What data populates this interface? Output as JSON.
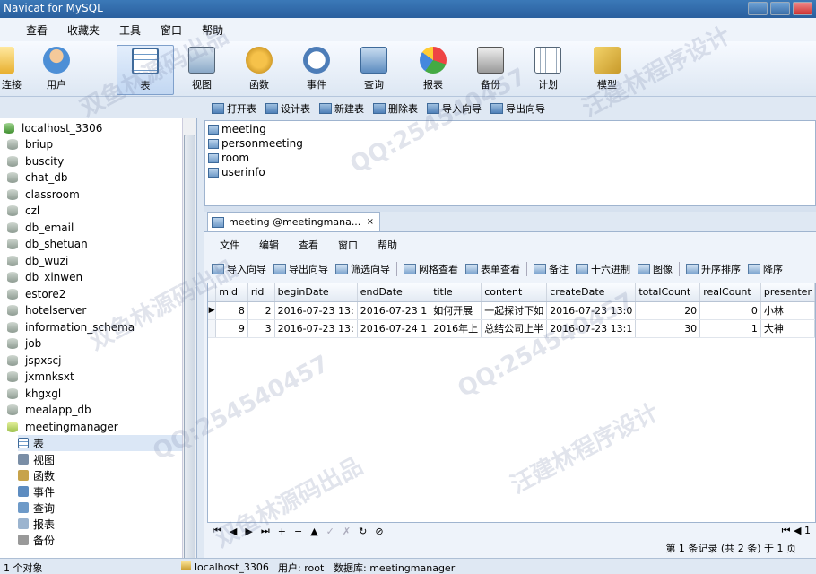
{
  "window": {
    "title": "Navicat for MySQL"
  },
  "menubar": [
    "查看",
    "收藏夹",
    "工具",
    "窗口",
    "帮助"
  ],
  "toolbar": [
    {
      "label": "连接",
      "icon": "connection-icon",
      "active": false
    },
    {
      "label": "用户",
      "icon": "user-icon",
      "active": false
    },
    {
      "label": "表",
      "icon": "table-icon",
      "active": true
    },
    {
      "label": "视图",
      "icon": "view-icon",
      "active": false
    },
    {
      "label": "函数",
      "icon": "function-icon",
      "active": false
    },
    {
      "label": "事件",
      "icon": "event-icon",
      "active": false
    },
    {
      "label": "查询",
      "icon": "query-icon",
      "active": false
    },
    {
      "label": "报表",
      "icon": "report-icon",
      "active": false
    },
    {
      "label": "备份",
      "icon": "backup-icon",
      "active": false
    },
    {
      "label": "计划",
      "icon": "schedule-icon",
      "active": false
    },
    {
      "label": "模型",
      "icon": "model-icon",
      "active": false
    }
  ],
  "object_toolbar": [
    "打开表",
    "设计表",
    "新建表",
    "删除表",
    "导入向导",
    "导出向导"
  ],
  "tree": {
    "connection": "localhost_3306",
    "databases": [
      "briup",
      "buscity",
      "chat_db",
      "classroom",
      "czl",
      "db_email",
      "db_shetuan",
      "db_wuzi",
      "db_xinwen",
      "estore2",
      "hotelserver",
      "information_schema",
      "job",
      "jspxscj",
      "jxmnksxt",
      "khgxgl",
      "mealapp_db",
      "meetingmanager"
    ],
    "sub_items": [
      "表",
      "视图",
      "函数",
      "事件",
      "查询",
      "报表",
      "备份"
    ]
  },
  "tables": [
    "meeting",
    "personmeeting",
    "room",
    "userinfo"
  ],
  "tab": {
    "label": "meeting @meetingmana...",
    "close": "×"
  },
  "inner_menu": [
    "文件",
    "编辑",
    "查看",
    "窗口",
    "帮助"
  ],
  "inner_toolbar": [
    "导入向导",
    "导出向导",
    "筛选向导",
    "网格查看",
    "表单查看",
    "备注",
    "十六进制",
    "图像",
    "升序排序",
    "降序"
  ],
  "grid": {
    "columns": [
      "mid",
      "rid",
      "beginDate",
      "endDate",
      "title",
      "content",
      "createDate",
      "totalCount",
      "realCount",
      "presenter"
    ],
    "rows": [
      [
        "8",
        "2",
        "2016-07-23 13:",
        "2016-07-23 1",
        "如何开展",
        "一起探讨下如",
        "2016-07-23 13:0",
        "20",
        "0",
        "小林"
      ],
      [
        "9",
        "3",
        "2016-07-23 13:",
        "2016-07-24 1",
        "2016年上",
        "总结公司上半",
        "2016-07-23 13:1",
        "30",
        "1",
        "大神"
      ]
    ]
  },
  "navigation": {
    "buttons": [
      "⏮",
      "◀",
      "▶",
      "⏭",
      "+",
      "−",
      "▲",
      "✓",
      "✗",
      "↻",
      "⊘"
    ],
    "page": "1"
  },
  "record_info": "第 1 条记录 (共 2 条) 于 1 页",
  "status": {
    "objects": "1 个对象",
    "connection": "localhost_3306",
    "user": "用户: root",
    "database": "数据库: meetingmanager"
  },
  "watermarks": [
    "双鱼林源码出品",
    "QQ:254540457",
    "汪建林程序设计",
    "双鱼林源码出品",
    "QQ:254540457",
    "汪建林程序设计",
    "QQ:254540457",
    "双鱼林源码出品"
  ],
  "colors": {
    "accent": "#2a5f9e",
    "selection": "#dbe7f6"
  }
}
